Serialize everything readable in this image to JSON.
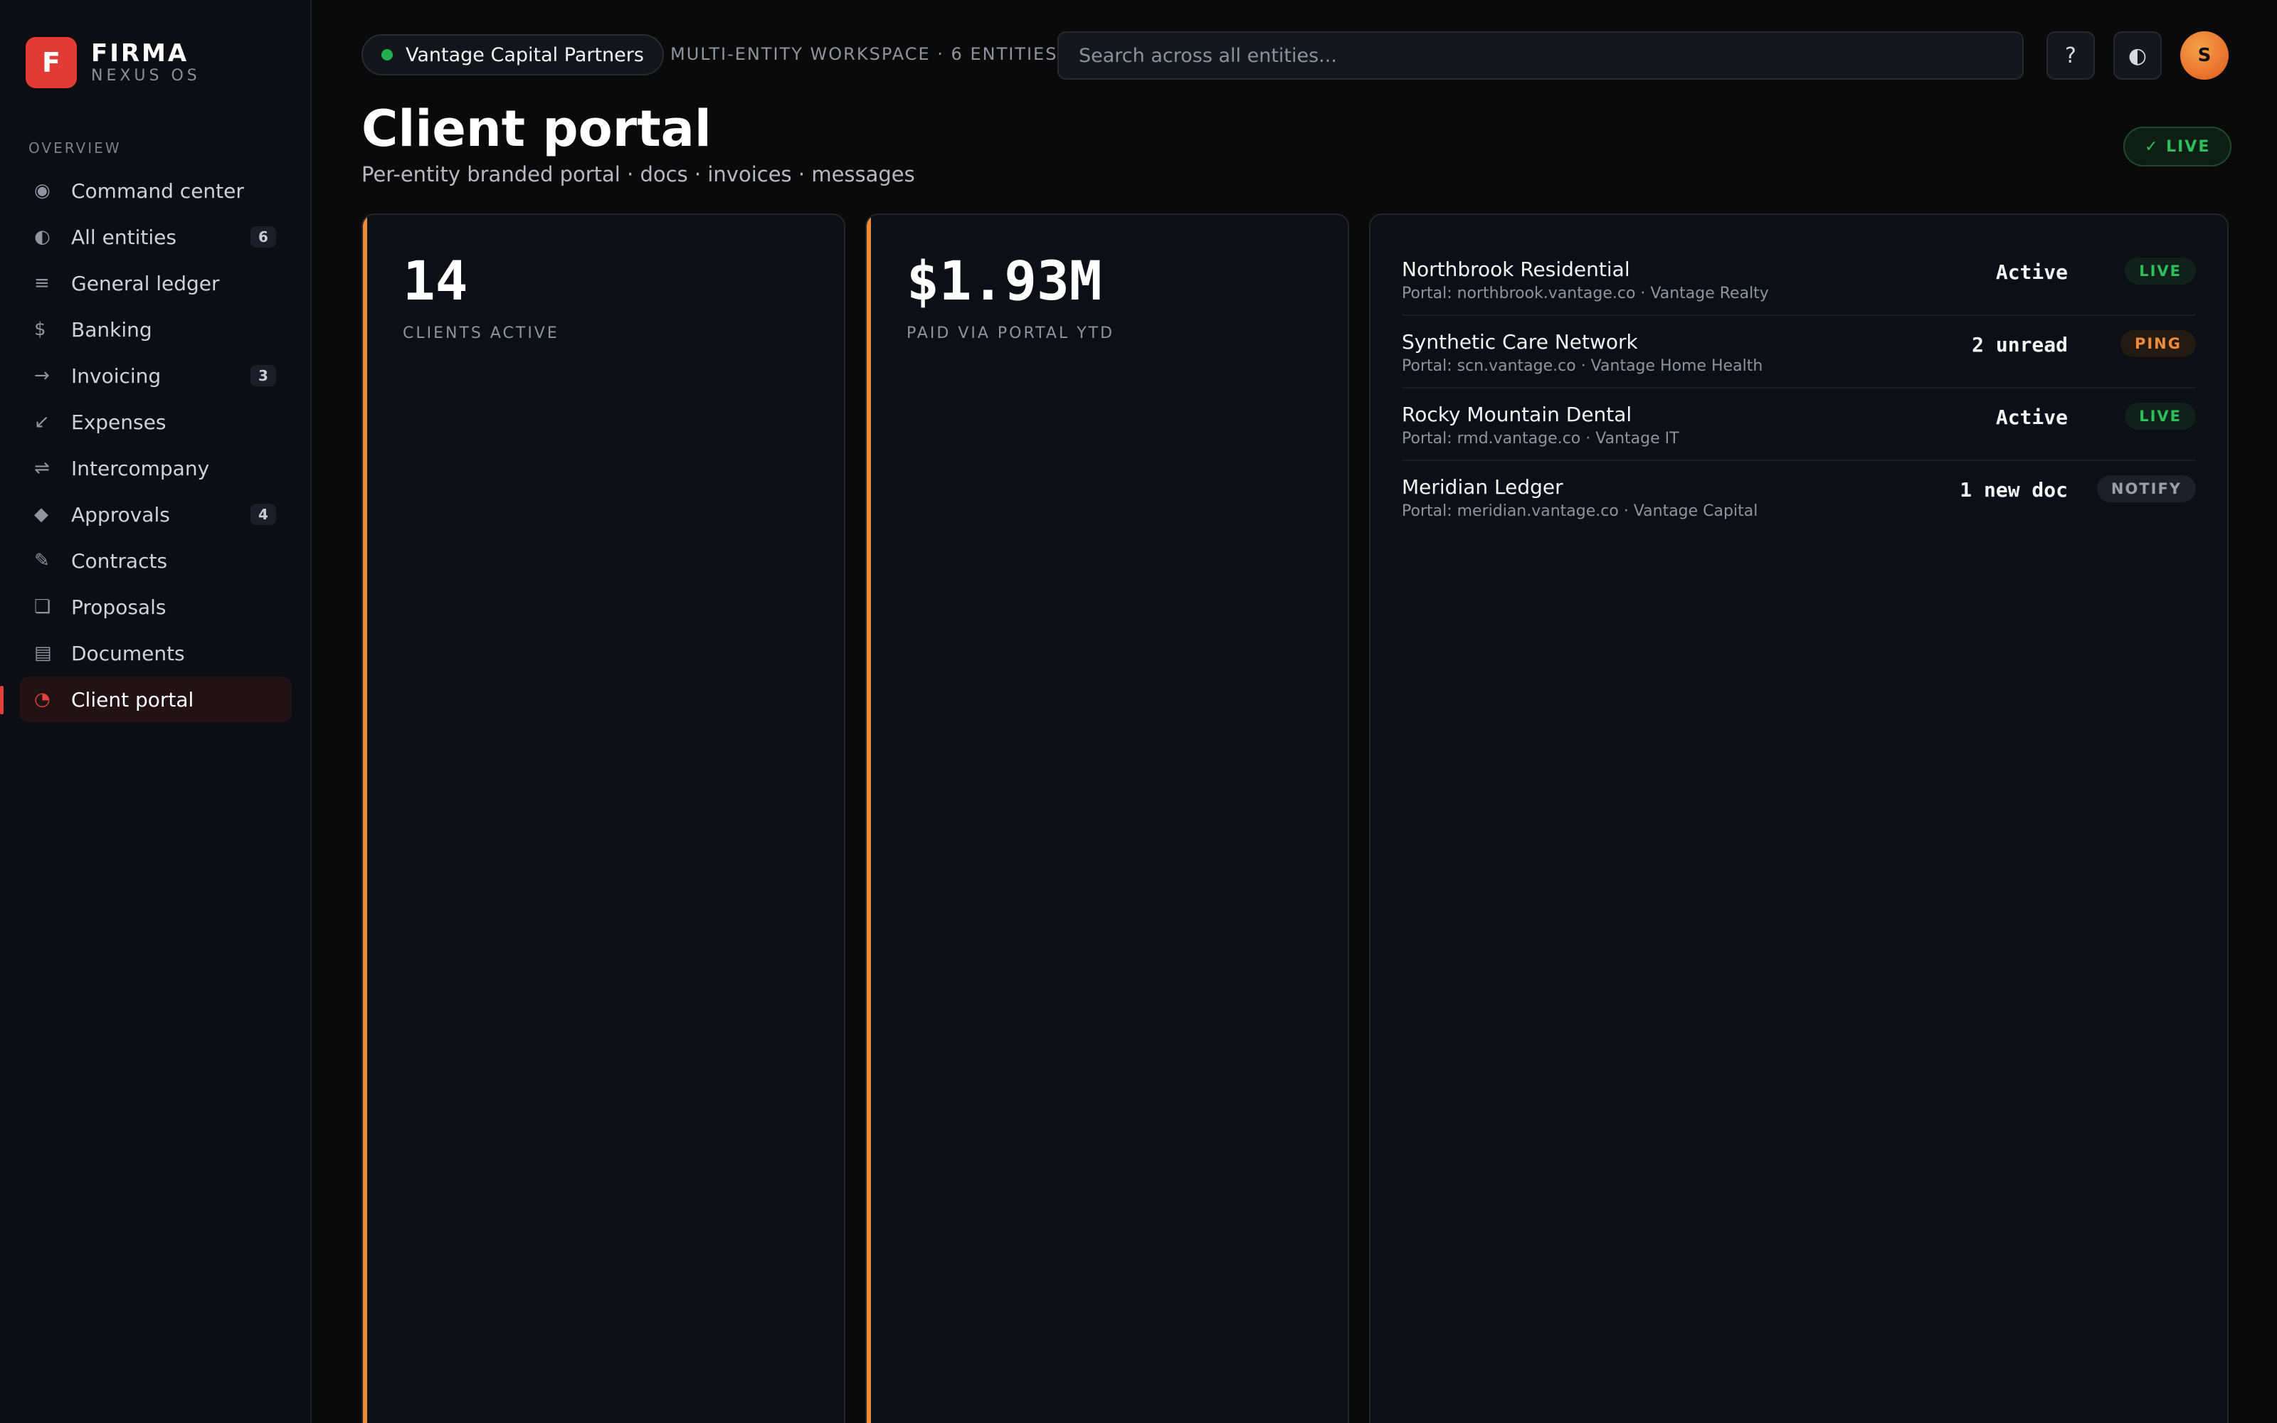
{
  "brand": {
    "logo_letter": "F",
    "name": "FIRMA",
    "subtitle": "NEXUS OS"
  },
  "sidebar": {
    "section_label": "OVERVIEW",
    "items": [
      {
        "icon": "◉",
        "icon_name": "target-icon",
        "label": "Command center",
        "badge": ""
      },
      {
        "icon": "◐",
        "icon_name": "half-circle-icon",
        "label": "All entities",
        "badge": "6"
      },
      {
        "icon": "≡",
        "icon_name": "ledger-icon",
        "label": "General ledger",
        "badge": ""
      },
      {
        "icon": "$",
        "icon_name": "dollar-icon",
        "label": "Banking",
        "badge": ""
      },
      {
        "icon": "→",
        "icon_name": "arrow-right-icon",
        "label": "Invoicing",
        "badge": "3"
      },
      {
        "icon": "↙",
        "icon_name": "arrow-down-left-icon",
        "label": "Expenses",
        "badge": ""
      },
      {
        "icon": "⇌",
        "icon_name": "exchange-icon",
        "label": "Intercompany",
        "badge": ""
      },
      {
        "icon": "◆",
        "icon_name": "diamond-icon",
        "label": "Approvals",
        "badge": "4"
      },
      {
        "icon": "✎",
        "icon_name": "pen-icon",
        "label": "Contracts",
        "badge": ""
      },
      {
        "icon": "❏",
        "icon_name": "copy-icon",
        "label": "Proposals",
        "badge": ""
      },
      {
        "icon": "▤",
        "icon_name": "document-icon",
        "label": "Documents",
        "badge": ""
      },
      {
        "icon": "◔",
        "icon_name": "portal-icon",
        "label": "Client portal",
        "badge": "",
        "active": true
      }
    ]
  },
  "topbar": {
    "workspace": "Vantage Capital Partners",
    "workspace_meta": "MULTI-ENTITY WORKSPACE · 6 ENTITIES",
    "search_placeholder": "Search across all entities...",
    "help_icon": "?",
    "theme_icon": "◐",
    "avatar_initial": "S"
  },
  "header": {
    "title": "Client portal",
    "subtitle": "Per-entity branded portal · docs · invoices · messages",
    "live_badge": "✓ LIVE"
  },
  "kpis": [
    {
      "value": "14",
      "label": "CLIENTS ACTIVE"
    },
    {
      "value": "$1.93M",
      "label": "PAID VIA PORTAL YTD"
    }
  ],
  "portals": [
    {
      "name": "Northbrook Residential",
      "detail": "Portal: northbrook.vantage.co · Vantage Realty",
      "status": "Active",
      "tag": "LIVE"
    },
    {
      "name": "Synthetic Care Network",
      "detail": "Portal: scn.vantage.co · Vantage Home Health",
      "status": "2 unread",
      "tag": "PING"
    },
    {
      "name": "Rocky Mountain Dental",
      "detail": "Portal: rmd.vantage.co · Vantage IT",
      "status": "Active",
      "tag": "LIVE"
    },
    {
      "name": "Meridian Ledger",
      "detail": "Portal: meridian.vantage.co · Vantage Capital",
      "status": "1 new doc",
      "tag": "NOTIFY"
    }
  ],
  "colors": {
    "accent": "#e2413c",
    "kpi_accent": "#f08a37",
    "live": "#2fbf5a",
    "ping": "#f08a37",
    "notify": "#9ba0ab"
  }
}
